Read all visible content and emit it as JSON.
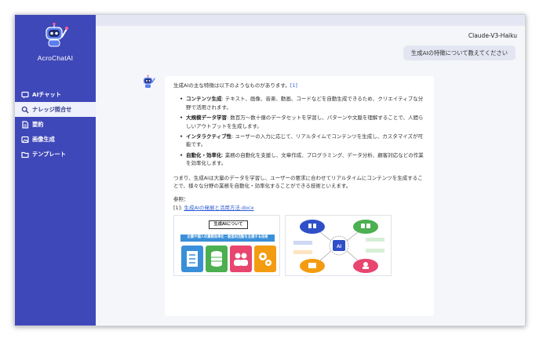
{
  "app": {
    "name": "AcroChatAI"
  },
  "sidebar": {
    "items": [
      {
        "label": "AIチャット",
        "icon": "chat-icon",
        "active": false
      },
      {
        "label": "ナレッジ照合せ",
        "icon": "search-icon",
        "active": true
      },
      {
        "label": "要約",
        "icon": "document-icon",
        "active": false
      },
      {
        "label": "画像生成",
        "icon": "image-icon",
        "active": false
      },
      {
        "label": "テンプレート",
        "icon": "folder-icon",
        "active": false
      }
    ]
  },
  "header": {
    "model": "Claude-V3-Haiku"
  },
  "conversation": {
    "user_message": "生成AIの特徴について教えてください",
    "answer": {
      "intro": "生成AIの主な特徴は以下のようなものがあります。",
      "intro_ref": "[1]",
      "bullets": [
        {
          "title": "コンテンツ生成",
          "text": ": テキスト、画像、音楽、動画、コードなどを自動生成できるため、クリエイティブな分野で活用されます。"
        },
        {
          "title": "大規模データ学習",
          "text": ": 数百万〜数十億のデータセットを学習し、パターンや文脈を理解することで、人間らしいアウトプットを生成します。"
        },
        {
          "title": "インタラクティブ性",
          "text": ": ユーザーの入力に応じて、リアルタイムでコンテンツを生成し、カスタマイズが可能です。"
        },
        {
          "title": "自動化・効率化",
          "text": ": 業務の自動化を支援し、文章作成、プログラミング、データ分析、顧客対応などの作業を効率化します。"
        }
      ],
      "summary": "つまり、生成AIは大量のデータを学習し、ユーザーの要求に合わせてリアルタイムにコンテンツを生成することで、様々な分野の業務を自動化・効率化することができる技術といえます。",
      "refs_label": "参照：",
      "ref_index": "[1]: ",
      "ref_doc": "生成AIの発展と活用方法.docx",
      "thumb1": {
        "title": "生成AIについて",
        "band": "企業や個人の業務効率化・創造的活動を支援する技術"
      },
      "thumb2": {
        "center": "AI"
      }
    }
  },
  "colors": {
    "sidebar": "#3f48b8",
    "accent_blue": "#3a8fd8",
    "green": "#4caf50",
    "pink": "#e8456f",
    "orange": "#f39c12"
  }
}
